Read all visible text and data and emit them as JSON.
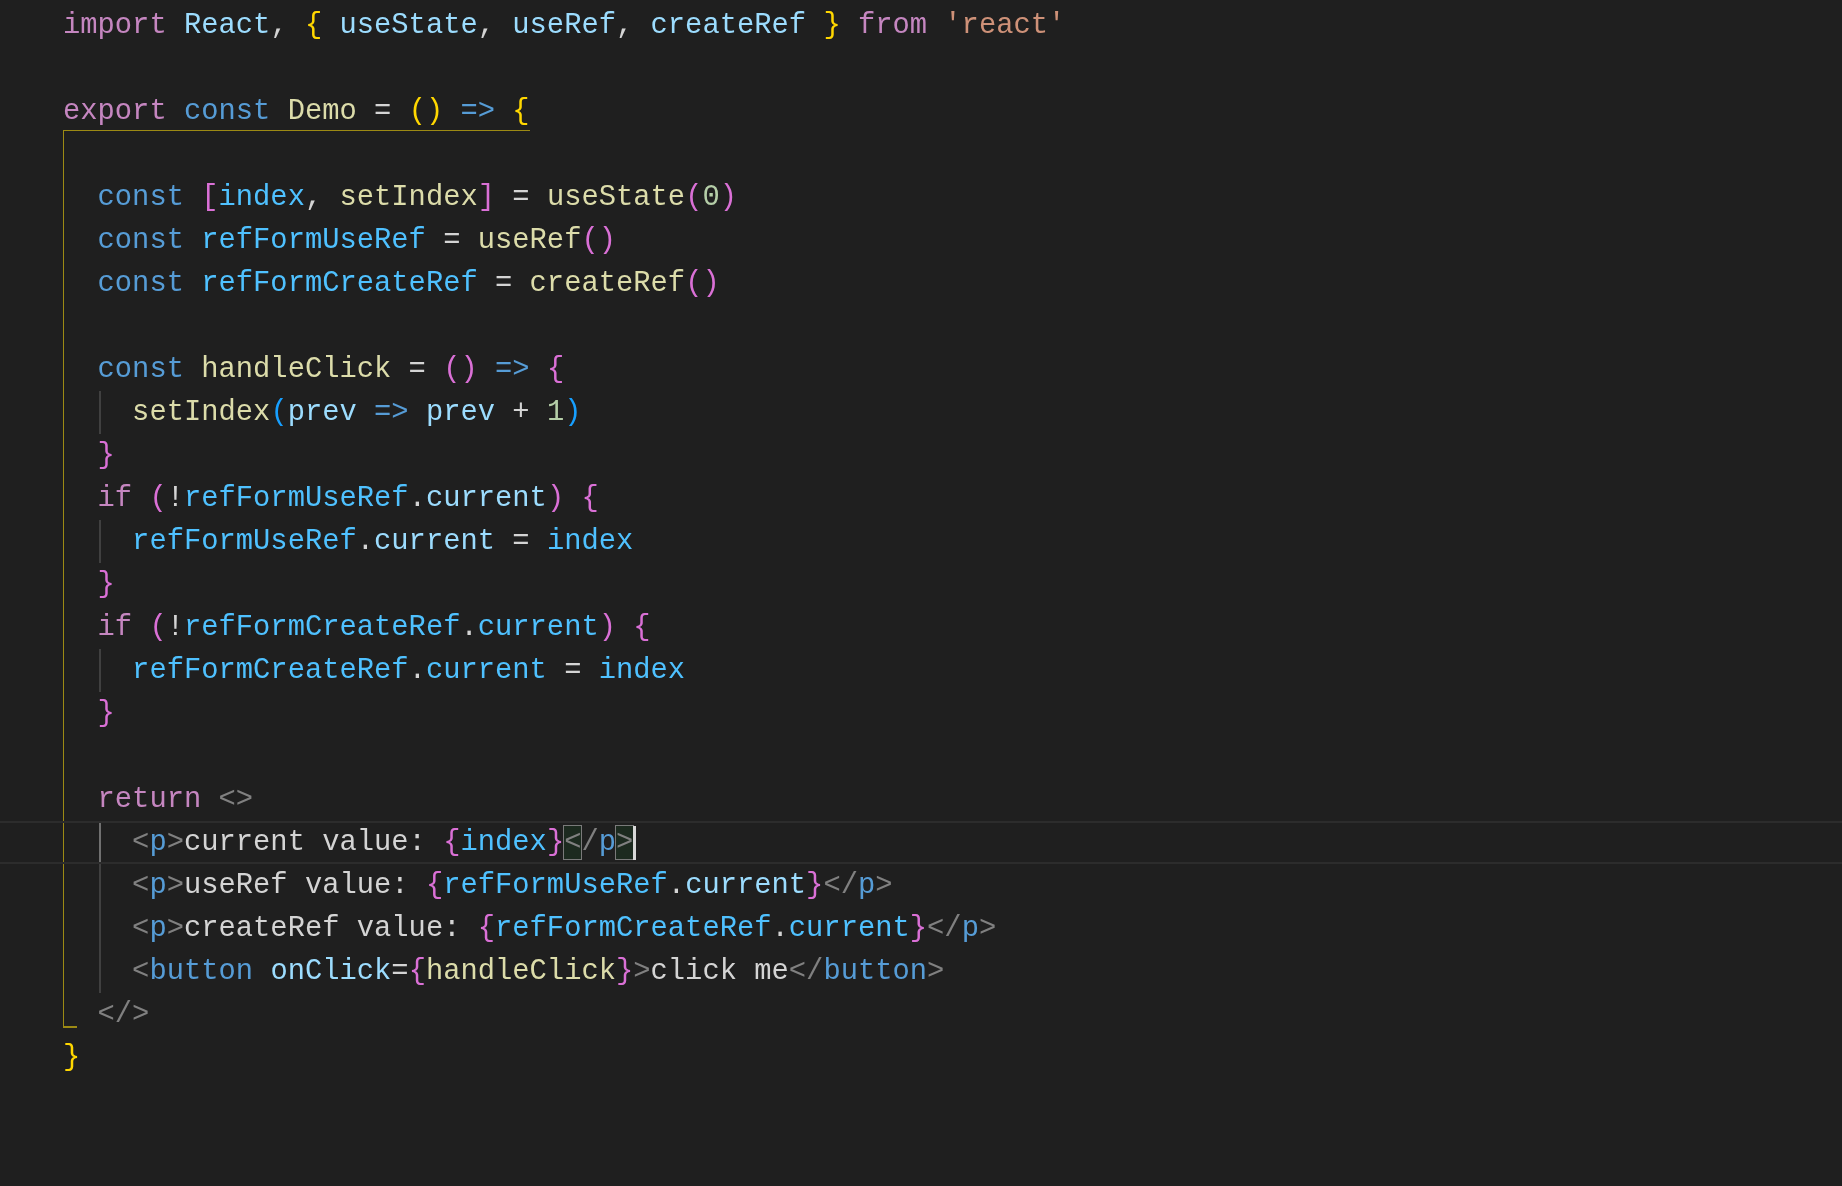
{
  "editor": {
    "lines": [
      {
        "kind": "code",
        "current": false,
        "tokens": [
          {
            "text": "import ",
            "kind": "kw"
          },
          {
            "text": "React",
            "kind": "var"
          },
          {
            "text": ", ",
            "kind": "plain"
          },
          {
            "text": "{",
            "kind": "b1"
          },
          {
            "text": " useState",
            "kind": "var"
          },
          {
            "text": ", ",
            "kind": "plain"
          },
          {
            "text": "useRef",
            "kind": "var"
          },
          {
            "text": ", ",
            "kind": "plain"
          },
          {
            "text": "createRef ",
            "kind": "var"
          },
          {
            "text": "} ",
            "kind": "b1"
          },
          {
            "text": "from ",
            "kind": "kw"
          },
          {
            "text": "'react'",
            "kind": "str"
          }
        ]
      },
      {
        "kind": "blank",
        "current": false
      },
      {
        "kind": "code",
        "current": false,
        "tokens": [
          {
            "text": "export ",
            "kind": "kw"
          },
          {
            "text": "const ",
            "kind": "storage"
          },
          {
            "text": "Demo",
            "kind": "fn"
          },
          {
            "text": " = ",
            "kind": "plain"
          },
          {
            "text": "() ",
            "kind": "b1"
          },
          {
            "text": "=> ",
            "kind": "storage"
          },
          {
            "text": "{",
            "kind": "b1"
          }
        ]
      },
      {
        "kind": "blank",
        "current": false
      },
      {
        "kind": "code",
        "current": false,
        "tokens": [
          {
            "text": "  const ",
            "kind": "storage"
          },
          {
            "text": "[",
            "kind": "b2"
          },
          {
            "text": "index",
            "kind": "const"
          },
          {
            "text": ", ",
            "kind": "plain"
          },
          {
            "text": "setIndex",
            "kind": "fn"
          },
          {
            "text": "]",
            "kind": "b2"
          },
          {
            "text": " = ",
            "kind": "plain"
          },
          {
            "text": "useState",
            "kind": "fn"
          },
          {
            "text": "(",
            "kind": "b2"
          },
          {
            "text": "0",
            "kind": "num"
          },
          {
            "text": ")",
            "kind": "b2"
          }
        ]
      },
      {
        "kind": "code",
        "current": false,
        "tokens": [
          {
            "text": "  const ",
            "kind": "storage"
          },
          {
            "text": "refFormUseRef",
            "kind": "const"
          },
          {
            "text": " = ",
            "kind": "plain"
          },
          {
            "text": "useRef",
            "kind": "fn"
          },
          {
            "text": "()",
            "kind": "b2"
          }
        ]
      },
      {
        "kind": "code",
        "current": false,
        "tokens": [
          {
            "text": "  const ",
            "kind": "storage"
          },
          {
            "text": "refFormCreateRef",
            "kind": "const"
          },
          {
            "text": " = ",
            "kind": "plain"
          },
          {
            "text": "createRef",
            "kind": "fn"
          },
          {
            "text": "()",
            "kind": "b2"
          }
        ]
      },
      {
        "kind": "blank",
        "current": false
      },
      {
        "kind": "code",
        "current": false,
        "tokens": [
          {
            "text": "  const ",
            "kind": "storage"
          },
          {
            "text": "handleClick",
            "kind": "fn"
          },
          {
            "text": " = ",
            "kind": "plain"
          },
          {
            "text": "() ",
            "kind": "b2"
          },
          {
            "text": "=> ",
            "kind": "storage"
          },
          {
            "text": "{",
            "kind": "b2"
          }
        ]
      },
      {
        "kind": "code",
        "current": false,
        "tokens": [
          {
            "text": "    setIndex",
            "kind": "fn"
          },
          {
            "text": "(",
            "kind": "b3"
          },
          {
            "text": "prev ",
            "kind": "var"
          },
          {
            "text": "=> ",
            "kind": "storage"
          },
          {
            "text": "prev",
            "kind": "var"
          },
          {
            "text": " + ",
            "kind": "plain"
          },
          {
            "text": "1",
            "kind": "num"
          },
          {
            "text": ")",
            "kind": "b3"
          }
        ]
      },
      {
        "kind": "code",
        "current": false,
        "tokens": [
          {
            "text": "  }",
            "kind": "b2"
          }
        ]
      },
      {
        "kind": "code",
        "current": false,
        "tokens": [
          {
            "text": "  if ",
            "kind": "kw"
          },
          {
            "text": "(",
            "kind": "b2"
          },
          {
            "text": "!",
            "kind": "plain"
          },
          {
            "text": "refFormUseRef",
            "kind": "const"
          },
          {
            "text": ".",
            "kind": "plain"
          },
          {
            "text": "current",
            "kind": "var"
          },
          {
            "text": ") ",
            "kind": "b2"
          },
          {
            "text": "{",
            "kind": "b2"
          }
        ]
      },
      {
        "kind": "code",
        "current": false,
        "tokens": [
          {
            "text": "    refFormUseRef",
            "kind": "const"
          },
          {
            "text": ".",
            "kind": "plain"
          },
          {
            "text": "current",
            "kind": "var"
          },
          {
            "text": " = ",
            "kind": "plain"
          },
          {
            "text": "index",
            "kind": "const"
          }
        ]
      },
      {
        "kind": "code",
        "current": false,
        "tokens": [
          {
            "text": "  }",
            "kind": "b2"
          }
        ]
      },
      {
        "kind": "code",
        "current": false,
        "tokens": [
          {
            "text": "  if ",
            "kind": "kw"
          },
          {
            "text": "(",
            "kind": "b2"
          },
          {
            "text": "!",
            "kind": "plain"
          },
          {
            "text": "refFormCreateRef",
            "kind": "const"
          },
          {
            "text": ".",
            "kind": "plain"
          },
          {
            "text": "current",
            "kind": "const"
          },
          {
            "text": ") ",
            "kind": "b2"
          },
          {
            "text": "{",
            "kind": "b2"
          }
        ]
      },
      {
        "kind": "code",
        "current": false,
        "tokens": [
          {
            "text": "    refFormCreateRef",
            "kind": "const"
          },
          {
            "text": ".",
            "kind": "plain"
          },
          {
            "text": "current",
            "kind": "const"
          },
          {
            "text": " = ",
            "kind": "plain"
          },
          {
            "text": "index",
            "kind": "const"
          }
        ]
      },
      {
        "kind": "code",
        "current": false,
        "tokens": [
          {
            "text": "  }",
            "kind": "b2"
          }
        ]
      },
      {
        "kind": "blank",
        "current": false
      },
      {
        "kind": "code",
        "current": false,
        "tokens": [
          {
            "text": "  return ",
            "kind": "kw"
          },
          {
            "text": "<>",
            "kind": "punct"
          }
        ]
      },
      {
        "kind": "code",
        "current": true,
        "tokens": [
          {
            "text": "    <",
            "kind": "punct"
          },
          {
            "text": "p",
            "kind": "tag"
          },
          {
            "text": ">",
            "kind": "punct"
          },
          {
            "text": "current value: ",
            "kind": "plain"
          },
          {
            "text": "{",
            "kind": "b2"
          },
          {
            "text": "index",
            "kind": "const"
          },
          {
            "text": "}",
            "kind": "b2"
          },
          {
            "text": "<",
            "kind": "punct",
            "matched": true
          },
          {
            "text": "/",
            "kind": "punct"
          },
          {
            "text": "p",
            "kind": "tag"
          },
          {
            "text": ">",
            "kind": "punct",
            "matched": true
          }
        ]
      },
      {
        "kind": "code",
        "current": false,
        "tokens": [
          {
            "text": "    <",
            "kind": "punct"
          },
          {
            "text": "p",
            "kind": "tag"
          },
          {
            "text": ">",
            "kind": "punct"
          },
          {
            "text": "useRef value: ",
            "kind": "plain"
          },
          {
            "text": "{",
            "kind": "b2"
          },
          {
            "text": "refFormUseRef",
            "kind": "const"
          },
          {
            "text": ".",
            "kind": "plain"
          },
          {
            "text": "current",
            "kind": "var"
          },
          {
            "text": "}",
            "kind": "b2"
          },
          {
            "text": "</",
            "kind": "punct"
          },
          {
            "text": "p",
            "kind": "tag"
          },
          {
            "text": ">",
            "kind": "punct"
          }
        ]
      },
      {
        "kind": "code",
        "current": false,
        "tokens": [
          {
            "text": "    <",
            "kind": "punct"
          },
          {
            "text": "p",
            "kind": "tag"
          },
          {
            "text": ">",
            "kind": "punct"
          },
          {
            "text": "createRef value: ",
            "kind": "plain"
          },
          {
            "text": "{",
            "kind": "b2"
          },
          {
            "text": "refFormCreateRef",
            "kind": "const"
          },
          {
            "text": ".",
            "kind": "plain"
          },
          {
            "text": "current",
            "kind": "const"
          },
          {
            "text": "}",
            "kind": "b2"
          },
          {
            "text": "</",
            "kind": "punct"
          },
          {
            "text": "p",
            "kind": "tag"
          },
          {
            "text": ">",
            "kind": "punct"
          }
        ]
      },
      {
        "kind": "code",
        "current": false,
        "tokens": [
          {
            "text": "    <",
            "kind": "punct"
          },
          {
            "text": "button ",
            "kind": "tag"
          },
          {
            "text": "onClick",
            "kind": "var"
          },
          {
            "text": "=",
            "kind": "plain"
          },
          {
            "text": "{",
            "kind": "b2"
          },
          {
            "text": "handleClick",
            "kind": "fn"
          },
          {
            "text": "}",
            "kind": "b2"
          },
          {
            "text": ">",
            "kind": "punct"
          },
          {
            "text": "click me",
            "kind": "plain"
          },
          {
            "text": "</",
            "kind": "punct"
          },
          {
            "text": "button",
            "kind": "tag"
          },
          {
            "text": ">",
            "kind": "punct"
          }
        ]
      },
      {
        "kind": "code",
        "current": false,
        "tokens": [
          {
            "text": "  </>",
            "kind": "punct"
          }
        ]
      },
      {
        "kind": "code",
        "current": false,
        "tokens": [
          {
            "text": "}",
            "kind": "b1"
          }
        ]
      }
    ]
  }
}
